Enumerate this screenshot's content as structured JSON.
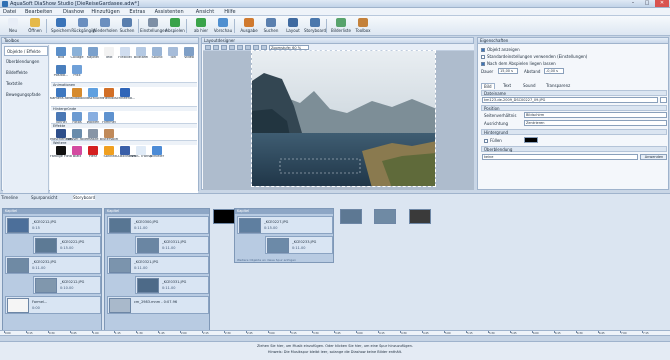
{
  "window": {
    "title": "AquaSoft DiaShow Studio [DieReiseGardasee.adw*]",
    "colors": {
      "accent": "#2f6fb3",
      "chrome": "#c9d6e6",
      "close": "#d9534f"
    }
  },
  "menu": [
    "Datei",
    "Bearbeiten",
    "Diashow",
    "Hinzufügen",
    "Extras",
    "Assistenten",
    "Ansicht",
    "Hilfe"
  ],
  "toolbar": [
    {
      "label": "Neu",
      "icon": "new-doc-icon",
      "color": "#e8eef7"
    },
    {
      "label": "Öffnen",
      "icon": "folder-open-icon",
      "color": "#e5b94a"
    },
    {
      "label": "Speichern",
      "icon": "save-icon",
      "color": "#3b74b8"
    },
    {
      "label": "Rückgängig",
      "icon": "undo-icon",
      "color": "#6b8fbf"
    },
    {
      "label": "Wiederholen",
      "icon": "redo-icon",
      "color": "#6b8fbf"
    },
    {
      "label": "Suchen",
      "icon": "search-icon",
      "color": "#5a7fae"
    },
    {
      "label": "Einstellungen",
      "icon": "settings-icon",
      "color": "#7d8fa6"
    },
    {
      "label": "Abspielen",
      "icon": "play-icon",
      "color": "#3aa34a"
    },
    {
      "label": "ab hier",
      "icon": "play-from-here-icon",
      "color": "#3aa34a"
    },
    {
      "label": "Vorschau",
      "icon": "preview-icon",
      "color": "#4f8fd0"
    },
    {
      "label": "Ausgabe",
      "icon": "output-icon",
      "color": "#d07a2f"
    },
    {
      "label": "Suchen",
      "icon": "find-icon",
      "color": "#5a7fae"
    },
    {
      "label": "Layout",
      "icon": "layout-icon",
      "color": "#3f6aa0"
    },
    {
      "label": "Storyboard",
      "icon": "storyboard-icon",
      "color": "#4b78ad"
    },
    {
      "label": "Bilderliste",
      "icon": "imagelist-icon",
      "color": "#58a36c"
    },
    {
      "label": "Toolbox",
      "icon": "toolbox-icon",
      "color": "#c4813a"
    }
  ],
  "toolbox": {
    "header": "Toolbox",
    "tabs": [
      "Objekte / Effekte",
      "Überblendungen",
      "Bildeffekte",
      "Textstile",
      "Bewegungspfade"
    ],
    "rows": [
      {
        "y": 0,
        "items": [
          {
            "label": "Bild",
            "color": "#5b8fc9"
          },
          {
            "label": "Collage",
            "color": "#8ab1d8"
          },
          {
            "label": "Kapitel",
            "color": "#7aa0cc"
          },
          {
            "label": "Text",
            "color": "#f2f2f2"
          },
          {
            "label": "Flexibel",
            "color": "#d0ddef"
          },
          {
            "label": "Bildtafel",
            "color": "#b4c9e3"
          },
          {
            "label": "Sound",
            "color": "#9ab5d6"
          },
          {
            "label": "Ton",
            "color": "#a6bcd9"
          },
          {
            "label": "Video",
            "color": "#7f9fc6"
          }
        ]
      },
      {
        "y": 18,
        "items": [
          {
            "label": "Positio...",
            "color": "#4a7fbd"
          },
          {
            "label": "Pixx",
            "color": "#6fa0d8"
          }
        ]
      }
    ],
    "groups": [
      {
        "label": "Animationen",
        "y": 35,
        "items": [
          {
            "label": "Kamera-fahrt",
            "color": "#3e78c0"
          },
          {
            "label": "Bildabl.",
            "color": "#d68b2e"
          },
          {
            "label": "Bildschlucht",
            "color": "#5fa0e0"
          },
          {
            "label": "Herbst",
            "color": "#d26f27"
          },
          {
            "label": "Schneeflo...",
            "color": "#2f65b8"
          }
        ]
      },
      {
        "label": "Hintergründe",
        "y": 59,
        "items": [
          {
            "label": "Tunnel",
            "color": "#4a78b5"
          },
          {
            "label": "Fotos",
            "color": "#6b9ad1"
          },
          {
            "label": "Wolken",
            "color": "#88aee0"
          },
          {
            "label": "Himmel",
            "color": "#5e92cf"
          }
        ]
      },
      {
        "label": "Effekte",
        "y": 76,
        "items": [
          {
            "label": "Maschenfilm",
            "color": "#2f4f8a"
          },
          {
            "label": "Wasser-fallen",
            "color": "#6a8cab"
          },
          {
            "label": "Maske",
            "color": "#8795a6"
          },
          {
            "label": "Bluterspiel",
            "color": "#c08a5a"
          }
        ]
      },
      {
        "label": "Weitere",
        "y": 93,
        "items": [
          {
            "label": "Farbige Hintergrund",
            "color": "#111111"
          },
          {
            "label": "Blatt",
            "color": "#d34aa0"
          },
          {
            "label": "Herz",
            "color": "#d42020"
          },
          {
            "label": "Sonne",
            "color": "#f0a020"
          },
          {
            "label": "3D-Bildrahmen",
            "color": "#3a5fa8"
          },
          {
            "label": "Weiß. Transparent",
            "color": "#e0ebf7"
          },
          {
            "label": "Schleier",
            "color": "#4c8bd6"
          }
        ]
      }
    ]
  },
  "designer": {
    "header": "Layoutdesigner",
    "zoom": "Zoomstufe: 60 %"
  },
  "properties": {
    "header": "Eigenschaften",
    "checks": [
      {
        "label": "Objekt anzeigen",
        "on": true
      },
      {
        "label": "Standardeinstellungen verwenden (Einstellungen)",
        "on": false
      },
      {
        "label": "Nach dem Abspielen liegen lassen",
        "on": true
      }
    ],
    "dauer_label": "Dauer",
    "dauer_value": "15,00 s",
    "abstand_label": "Abstand",
    "abstand_value": "-0,00 s",
    "tabs": [
      "Bild",
      "Text",
      "Sound",
      "Transparenz"
    ],
    "sections": {
      "datei": "Dateiname",
      "datei_value": "km123-de-2009_DSC00227_09.JPG",
      "position": "Position",
      "seitenverh_label": "Seitenverhältnis",
      "seitenverh_value": "Bildschirm",
      "ausrichtung_label": "Ausrichtung",
      "ausrichtung_value": "Zentrieren",
      "hintergrund": "Hintergrund",
      "fuellen_label": "Füllen",
      "ueberblendung": "Überblendung",
      "ueberblendung_value": "keine",
      "apply_label": "Anwenden"
    }
  },
  "timeline": {
    "tabs": [
      "Timeline",
      "Spurpansicht",
      "Storyboard"
    ],
    "chapters": [
      {
        "title": "Kapitel",
        "hint": "Weitere Objekte an diese Spur anfügen",
        "slides": [
          {
            "name": "_KCE0212.JPG",
            "dur": "0:15",
            "color": "#4c6f9a"
          },
          {
            "name": "_KCE0222.JPG",
            "dur": "0:15.00",
            "color": "#5d7a95"
          },
          {
            "name": "_KCE0232.JPG",
            "dur": "0:11.00",
            "color": "#6f8aa4"
          },
          {
            "name": "_KCE0212.JPG",
            "dur": "0:10.00",
            "color": "#8097ad"
          },
          {
            "name": "Formel...",
            "dur": "0:00",
            "color": "#f5f5f5"
          }
        ]
      },
      {
        "title": "Kapitel",
        "hint": "Weitere Objekte an diese Spur anfügen",
        "slides": [
          {
            "name": "_KCE0300.JPG",
            "dur": "0:11.00",
            "color": "#587693"
          },
          {
            "name": "_KCE0311.JPG",
            "dur": "0:11.00",
            "color": "#6a86a3"
          },
          {
            "name": "_KCE0321.JPG",
            "dur": "0:11.00",
            "color": "#7b94ad"
          },
          {
            "name": "_KCE0331.JPG",
            "dur": "0:11.00",
            "color": "#4d6a88"
          },
          {
            "name": "cm_2983.mnm - 0:07.96",
            "dur": "",
            "color": "#a9b9cb"
          }
        ]
      },
      {
        "title": "Kapitel",
        "hint": "Weitere Objekte an diese Spur anfügen",
        "slides": [
          {
            "name": "_KCE0227.JPG",
            "dur": "0:15.00",
            "color": "#5f7fa0"
          },
          {
            "name": "_KCE0233.JPG",
            "dur": "0:11.00",
            "color": "#6c8aa8"
          }
        ]
      }
    ],
    "ruler": [
      "0:00",
      "0:15",
      "0:30",
      "0:45",
      "1:00",
      "1:15",
      "1:30",
      "1:45",
      "2:00",
      "2:15",
      "2:30",
      "2:45",
      "3:00",
      "3:15",
      "3:30",
      "3:45",
      "4:00",
      "4:15",
      "4:30",
      "4:45",
      "5:00",
      "5:15",
      "5:30",
      "5:45",
      "6:00",
      "6:15",
      "6:30",
      "6:45",
      "7:00",
      "7:15"
    ],
    "status": [
      "Ziehen Sie hier, um Musik einzufügen. Oder klicken Sie hier, um eine Spur hinzuzufügen.",
      "Hinweis: Die Musikspur bleibt leer, solange die Diashow keine Bilder enthält."
    ]
  }
}
